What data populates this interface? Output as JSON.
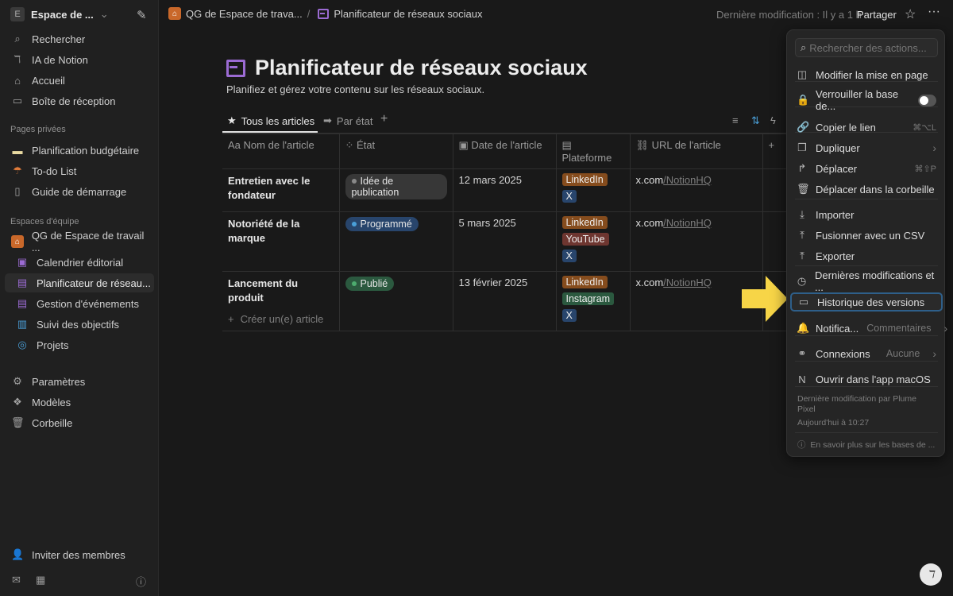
{
  "sidebar": {
    "workspace": "Espace de ...",
    "workspace_initial": "E",
    "top": [
      {
        "label": "Rechercher",
        "icon": "search-icon"
      },
      {
        "label": "IA de Notion",
        "icon": "notion-ai-icon"
      },
      {
        "label": "Accueil",
        "icon": "home-icon"
      },
      {
        "label": "Boîte de réception",
        "icon": "inbox-icon"
      }
    ],
    "private_label": "Pages privées",
    "private": [
      {
        "label": "Planification budgétaire",
        "icon": "card-icon"
      },
      {
        "label": "To-do List",
        "icon": "parachute-icon"
      },
      {
        "label": "Guide de démarrage",
        "icon": "document-icon"
      }
    ],
    "team_label": "Espaces d'équipe",
    "team_root": "QG de Espace de travail ...",
    "team": [
      {
        "label": "Calendrier éditorial",
        "icon": "calendar-icon"
      },
      {
        "label": "Planificateur de réseau...",
        "icon": "table-icon"
      },
      {
        "label": "Gestion d'événements",
        "icon": "table-icon"
      },
      {
        "label": "Suivi des objectifs",
        "icon": "chart-icon"
      },
      {
        "label": "Projets",
        "icon": "target-icon"
      }
    ],
    "bottom": [
      {
        "label": "Paramètres",
        "icon": "gear-icon"
      },
      {
        "label": "Modèles",
        "icon": "templates-icon"
      },
      {
        "label": "Corbeille",
        "icon": "trash-icon"
      }
    ],
    "invite": "Inviter des membres"
  },
  "topbar": {
    "breadcrumb_root": "QG de Espace de trava...",
    "breadcrumb_sep": "/",
    "breadcrumb_page": "Planificateur de réseaux sociaux",
    "last_modified": "Dernière modification : Il y a 1 h",
    "share": "Partager"
  },
  "page": {
    "title": "Planificateur de réseaux sociaux",
    "description": "Planifiez et gérez votre contenu sur les réseaux sociaux.",
    "views": [
      "Tous les articles",
      "Par état"
    ],
    "columns": [
      "Nom de l'article",
      "État",
      "Date de l'article",
      "Plateforme",
      "URL de l'article"
    ],
    "column_prefix": "Aa",
    "rows": [
      {
        "name": "Entretien avec le fondateur",
        "status": "Idée de publication",
        "status_color": "#8a8a8a",
        "status_bg": "#373737",
        "date": "12 mars 2025",
        "platforms": [
          "LinkedIn",
          "X"
        ],
        "url": "x.com",
        "url_path": "/NotionHQ"
      },
      {
        "name": "Notoriété de la marque",
        "status": "Programmé",
        "status_color": "#4a9fd8",
        "status_bg": "#28456c",
        "date": "5 mars 2025",
        "platforms": [
          "LinkedIn",
          "YouTube",
          "X"
        ],
        "url": "x.com",
        "url_path": "/NotionHQ"
      },
      {
        "name": "Lancement du produit",
        "status": "Publié",
        "status_color": "#4dab6f",
        "status_bg": "#2b593f",
        "date": "13 février 2025",
        "platforms": [
          "LinkedIn",
          "Instagram",
          "X"
        ],
        "url": "x.com",
        "url_path": "/NotionHQ"
      }
    ],
    "platform_colors": {
      "LinkedIn": "#854c1d",
      "X": "#28456c",
      "YouTube": "#6e3630",
      "Instagram": "#2b593f"
    },
    "create": "Créer un(e) article"
  },
  "menu": {
    "search_placeholder": "Rechercher des actions...",
    "items": [
      {
        "label": "Modifier la mise en page",
        "icon": "layout-icon"
      },
      {
        "label": "Verrouiller la base de...",
        "icon": "lock-icon",
        "toggle": false
      },
      {
        "label": "Copier le lien",
        "icon": "link-icon",
        "shortcut": "⌘⌥L"
      },
      {
        "label": "Dupliquer",
        "icon": "duplicate-icon",
        "chevron": "›"
      },
      {
        "label": "Déplacer",
        "icon": "move-icon",
        "shortcut": "⌘⇧P"
      },
      {
        "label": "Déplacer dans la corbeille",
        "icon": "trash-icon"
      },
      {
        "label": "Importer",
        "icon": "import-icon"
      },
      {
        "label": "Fusionner avec un CSV",
        "icon": "merge-icon"
      },
      {
        "label": "Exporter",
        "icon": "export-icon"
      },
      {
        "label": "Dernières modifications et ...",
        "icon": "clock-icon"
      },
      {
        "label": "Historique des versions",
        "icon": "history-icon"
      },
      {
        "label": "Notifica...",
        "icon": "bell-icon",
        "value": "Commentaires",
        "chevron": "›"
      },
      {
        "label": "Connexions",
        "icon": "connections-icon",
        "value": "Aucune",
        "chevron": "›"
      },
      {
        "label": "Ouvrir dans l'app macOS",
        "icon": "notion-app-icon"
      }
    ],
    "footer_edited": "Dernière modification par Plume Pixel",
    "footer_time": "Aujourd'hui à 10:27",
    "learn_more": "En savoir plus sur les bases de ..."
  },
  "colors": {
    "accent": "#2e5f8a",
    "page_icon": "#9b6bd3",
    "arrow": "#f7d547"
  }
}
